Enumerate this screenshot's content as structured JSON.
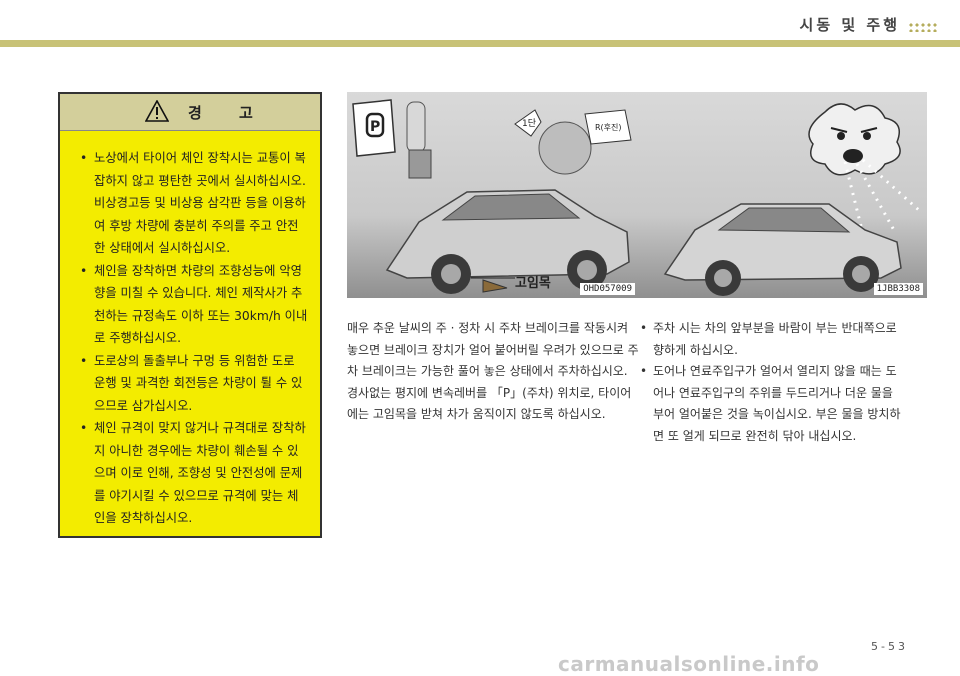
{
  "header": {
    "title": "시동 및 주행"
  },
  "warning": {
    "title": "경 고",
    "items": [
      "노상에서 타이어 체인 장착시는 교통이 복잡하지 않고 평탄한 곳에서 실시하십시오. 비상경고등 및 비상용 삼각판 등을 이용하여 후방 차량에 충분히 주의를 주고 안전한 상태에서 실시하십시오.",
      "체인을 장착하면 차량의 조향성능에 악영향을 미칠 수 있습니다. 체인 제작사가 추천하는 규정속도 이하 또는 30km/h 이내로 주행하십시오.",
      "도로상의 돌출부나 구멍 등 위험한 도로 운행 및 과격한 회전등은 차량이 튈 수 있으므로 삼가십시오.",
      "체인 규격이 맞지 않거나 규격대로 장착하지 아니한 경우에는 차량이 훼손될 수 있으며 이로 인해, 조향성 및 안전성에 문제를 야기시킬 수 있으므로 규격에 맞는 체인을 장착하십시오."
    ]
  },
  "photo_left": {
    "code": "OHD057009",
    "block_label": "고임목",
    "gear_label": "P",
    "step_label": "1단",
    "reverse_label": "R(후진)"
  },
  "photo_right": {
    "code": "1JBB3308"
  },
  "text_left": "매우 추운 날씨의 주 · 정차 시 주차 브레이크를 작동시켜 놓으면 브레이크 장치가 얼어 붙어버릴 우려가 있으므로 주차 브레이크는 가능한 풀어 놓은 상태에서 주차하십시오. 경사없는 평지에 변속레버를 「P」(주차) 위치로, 타이어에는 고임목을 받쳐 차가 움직이지 않도록 하십시오.",
  "notes": [
    "주차 시는 차의 앞부분을 바람이 부는 반대쪽으로 향하게 하십시오.",
    "도어나 연료주입구가 얼어서 열리지 않을 때는 도어나 연료주입구의 주위를 두드리거나 더운 물을 부어 얼어붙은 것을 녹이십시오. 부은 물을 방치하면 또 얼게 되므로 완전히 닦아 내십시오."
  ],
  "page_number": "5-53",
  "watermark": "carmanualsonline.info",
  "colors": {
    "warning_bg": "#f3ec00",
    "header_bar": "#c8c277"
  }
}
